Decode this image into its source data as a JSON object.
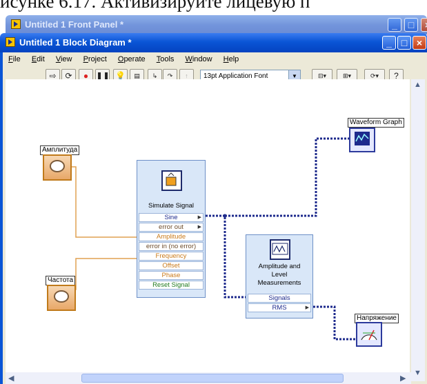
{
  "document_text": "исунке 6.17. Активизируйте лицевую п",
  "front_panel_window": {
    "title": "Untitled 1 Front Panel *"
  },
  "block_diagram_window": {
    "title": "Untitled 1 Block Diagram *",
    "menu": [
      "File",
      "Edit",
      "View",
      "Project",
      "Operate",
      "Tools",
      "Window",
      "Help"
    ],
    "toolbar": {
      "font": "13pt Application Font"
    }
  },
  "diagram": {
    "controls": [
      {
        "label": "Амплитуда"
      },
      {
        "label": "Частота"
      }
    ],
    "indicators": [
      {
        "label": "Waveform Graph"
      },
      {
        "label": "Напряжение"
      }
    ],
    "simulate_signal": {
      "title": "Simulate Signal",
      "rows": [
        "Sine",
        "error out",
        "Amplitude",
        "error in (no error)",
        "Frequency",
        "Offset",
        "Phase",
        "Reset Signal"
      ]
    },
    "amplitude_measurements": {
      "title_lines": [
        "Amplitude and",
        "Level",
        "Measurements"
      ],
      "rows": [
        "Signals",
        "RMS"
      ]
    }
  }
}
